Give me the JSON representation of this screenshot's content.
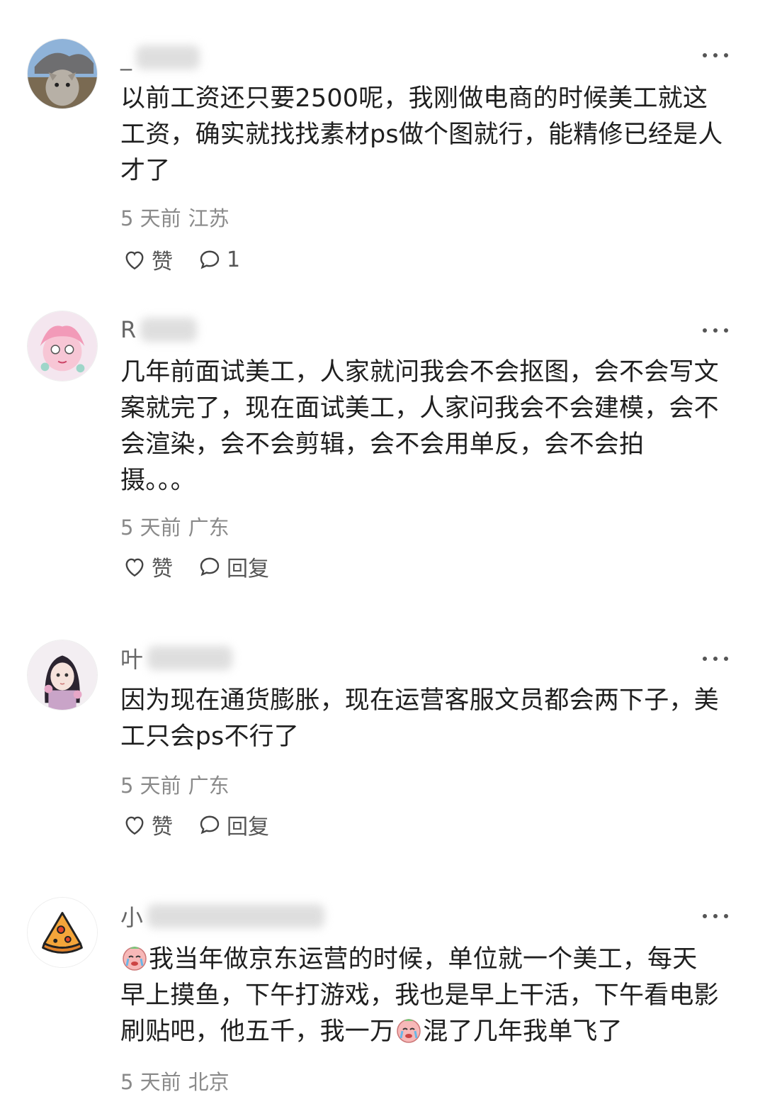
{
  "comments": [
    {
      "username_prefix": "_",
      "text": "以前工资还只要2500呢，我刚做电商的时候美工就这\n工资，确实就找找素材ps做个图就行，能精修已经是人\n才了",
      "time": "5 天前",
      "location": "江苏",
      "like_label": "赞",
      "reply_label": "1",
      "avatar_icon": "cat-photo-avatar"
    },
    {
      "username_prefix": "R",
      "text": "几年前面试美工，人家就问我会不会抠图，会不会写文\n案就完了，现在面试美工，人家问我会不会建模，会不\n会渲染，会不会剪辑，会不会用单反，会不会拍\n摄。。。",
      "time": "5 天前",
      "location": "广东",
      "like_label": "赞",
      "reply_label": "回复",
      "avatar_icon": "anime-pink-avatar"
    },
    {
      "username_prefix": "叶",
      "text": "因为现在通货膨胀，现在运营客服文员都会两下子，美\n工只会ps不行了",
      "time": "5 天前",
      "location": "广东",
      "like_label": "赞",
      "reply_label": "回复",
      "avatar_icon": "anime-girl-avatar"
    },
    {
      "username_prefix": "小",
      "text_line1": "我当年做京东运营的时候，单位就一个美工，每天",
      "text_line2": "早上摸鱼，下午打游戏，我也是早上干活，下午看电影",
      "text_line3_a": "刷贴吧，他五千，我一万",
      "text_line3_b": "混了几年我单飞了",
      "time": "5 天前",
      "location": "北京",
      "avatar_icon": "pizza-avatar"
    }
  ]
}
